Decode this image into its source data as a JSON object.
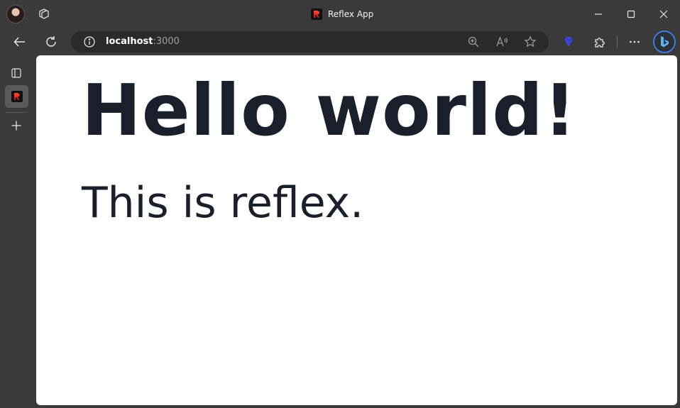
{
  "browser": {
    "tab_title": "Reflex App",
    "address": {
      "host": "localhost",
      "port": ":3000"
    },
    "icons": {
      "profile": "profile-avatar",
      "workspaces": "workspaces-icon",
      "back": "back-arrow-icon",
      "refresh": "refresh-icon",
      "info": "site-info-icon",
      "zoom": "zoom-in-icon",
      "read_aloud": "read-aloud-icon",
      "favorite": "star-icon",
      "extension_gem": "gem-icon",
      "extensions": "puzzle-icon",
      "more": "more-icon",
      "copilot": "bing-icon",
      "minimize": "minimize-icon",
      "maximize": "maximize-icon",
      "close": "close-icon",
      "tab_actions": "tab-actions-icon",
      "new_tab": "plus-icon"
    },
    "colors": {
      "chrome": "#3a3a3a",
      "address_bar": "#2a2a2a",
      "page_text": "#1b1e2b",
      "accent": "#3c7bd9"
    }
  },
  "page": {
    "heading": "Hello world!",
    "text": "This is reflex."
  }
}
